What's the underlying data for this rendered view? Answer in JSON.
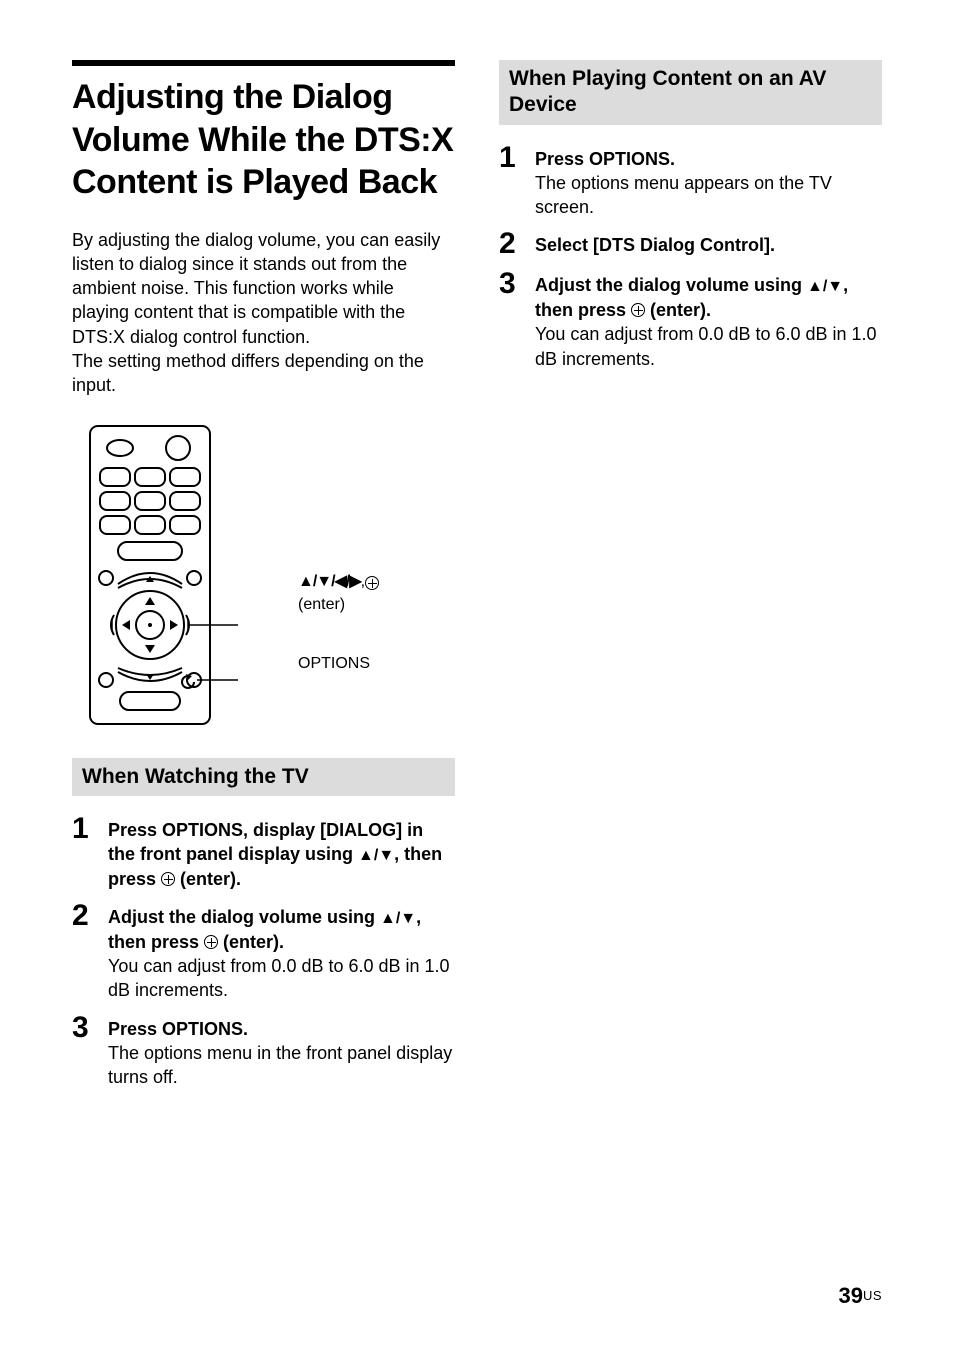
{
  "title": "Adjusting the Dialog Volume While the DTS:X Content is Played Back",
  "intro": "By adjusting the dialog volume, you can easily listen to dialog since it stands out from the ambient noise. This function works while playing content that is compatible with the DTS:X dialog control function.\nThe setting method differs depending on the input.",
  "remote": {
    "callout1_arrows": "↑/↓/←/→, ",
    "callout1_enter": "(enter)",
    "callout2": "OPTIONS"
  },
  "left": {
    "subhead": "When Watching the TV",
    "steps": [
      {
        "num": "1",
        "bold_pre": "Press OPTIONS, display [DIALOG] in the front panel display using ",
        "arrows": "↑/↓",
        "bold_mid": ", then press ",
        "bold_post": " (enter).",
        "body": ""
      },
      {
        "num": "2",
        "bold_pre": "Adjust the dialog volume using ",
        "arrows": "↑/↓",
        "bold_mid": ", then press ",
        "bold_post": " (enter).",
        "body": "You can adjust from 0.0 dB to 6.0 dB in 1.0 dB increments."
      },
      {
        "num": "3",
        "bold_pre": "Press OPTIONS.",
        "arrows": "",
        "bold_mid": "",
        "bold_post": "",
        "body": "The options menu in the front panel display turns off."
      }
    ]
  },
  "right": {
    "subhead": "When Playing Content on an AV Device",
    "steps": [
      {
        "num": "1",
        "bold_pre": "Press OPTIONS.",
        "arrows": "",
        "bold_mid": "",
        "bold_post": "",
        "body": "The options menu appears on the TV screen."
      },
      {
        "num": "2",
        "bold_pre": "Select [DTS Dialog Control].",
        "arrows": "",
        "bold_mid": "",
        "bold_post": "",
        "body": ""
      },
      {
        "num": "3",
        "bold_pre": "Adjust the dialog volume using ",
        "arrows": "↑/↓",
        "bold_mid": ", then press ",
        "bold_post": " (enter).",
        "body": "You can adjust from 0.0 dB to 6.0 dB in 1.0 dB increments."
      }
    ]
  },
  "footer": {
    "page": "39",
    "suffix": "US"
  }
}
